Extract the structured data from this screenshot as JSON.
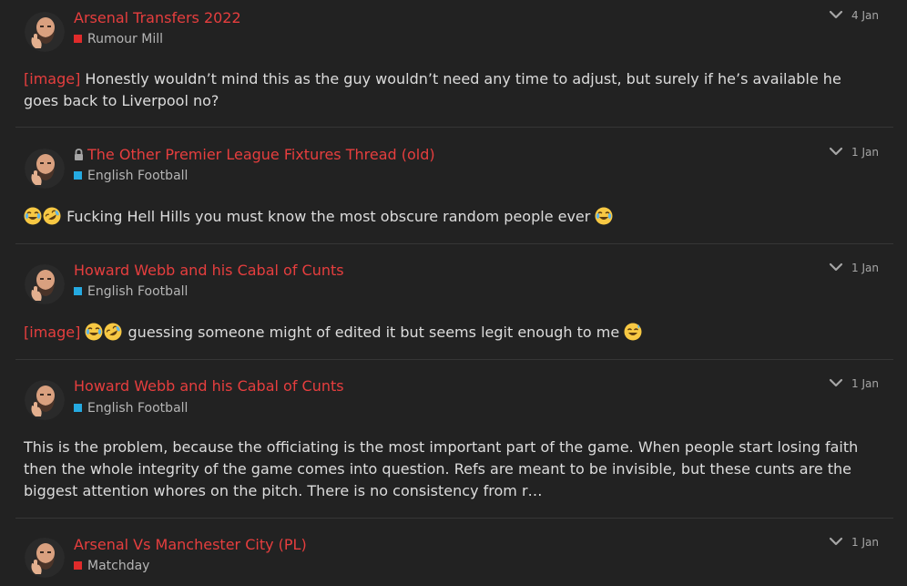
{
  "colors": {
    "background": "#222222",
    "title": "#e63e3e",
    "text": "#dcdcdc",
    "muted": "#b5b5b5",
    "divider": "#363636"
  },
  "posts": [
    {
      "title": "Arsenal Transfers 2022",
      "locked": false,
      "category": "Rumour Mill",
      "category_color": "#e02b2b",
      "date": "4 Jan",
      "excerpt_image_tag": "[image]",
      "excerpt_text": "Honestly wouldn’t mind this as the guy wouldn’t need any time to adjust, but surely if he’s available he goes back to Liverpool no?"
    },
    {
      "title": "The Other Premier League Fixtures Thread (old)",
      "locked": true,
      "category": "English Football",
      "category_color": "#25aae1",
      "date": "1 Jan",
      "excerpt_text": "Fucking Hell Hills you must know the most obscure random people ever"
    },
    {
      "title": "Howard Webb and his Cabal of Cunts",
      "locked": false,
      "category": "English Football",
      "category_color": "#25aae1",
      "date": "1 Jan",
      "excerpt_image_tag": "[image]",
      "excerpt_text": "guessing someone might of edited it but seems legit enough to me"
    },
    {
      "title": "Howard Webb and his Cabal of Cunts",
      "locked": false,
      "category": "English Football",
      "category_color": "#25aae1",
      "date": "1 Jan",
      "excerpt_text": "This is the problem, because the officiating is the most important part of the game. When people start losing faith then the whole integrity of the game comes into question. Refs are meant to be invisible, but these cunts are the biggest attention whores on the pitch. There is no consistency from r…"
    },
    {
      "title": "Arsenal Vs Manchester City (PL)",
      "locked": false,
      "category": "Matchday",
      "category_color": "#e02b2b",
      "date": "1 Jan"
    }
  ]
}
